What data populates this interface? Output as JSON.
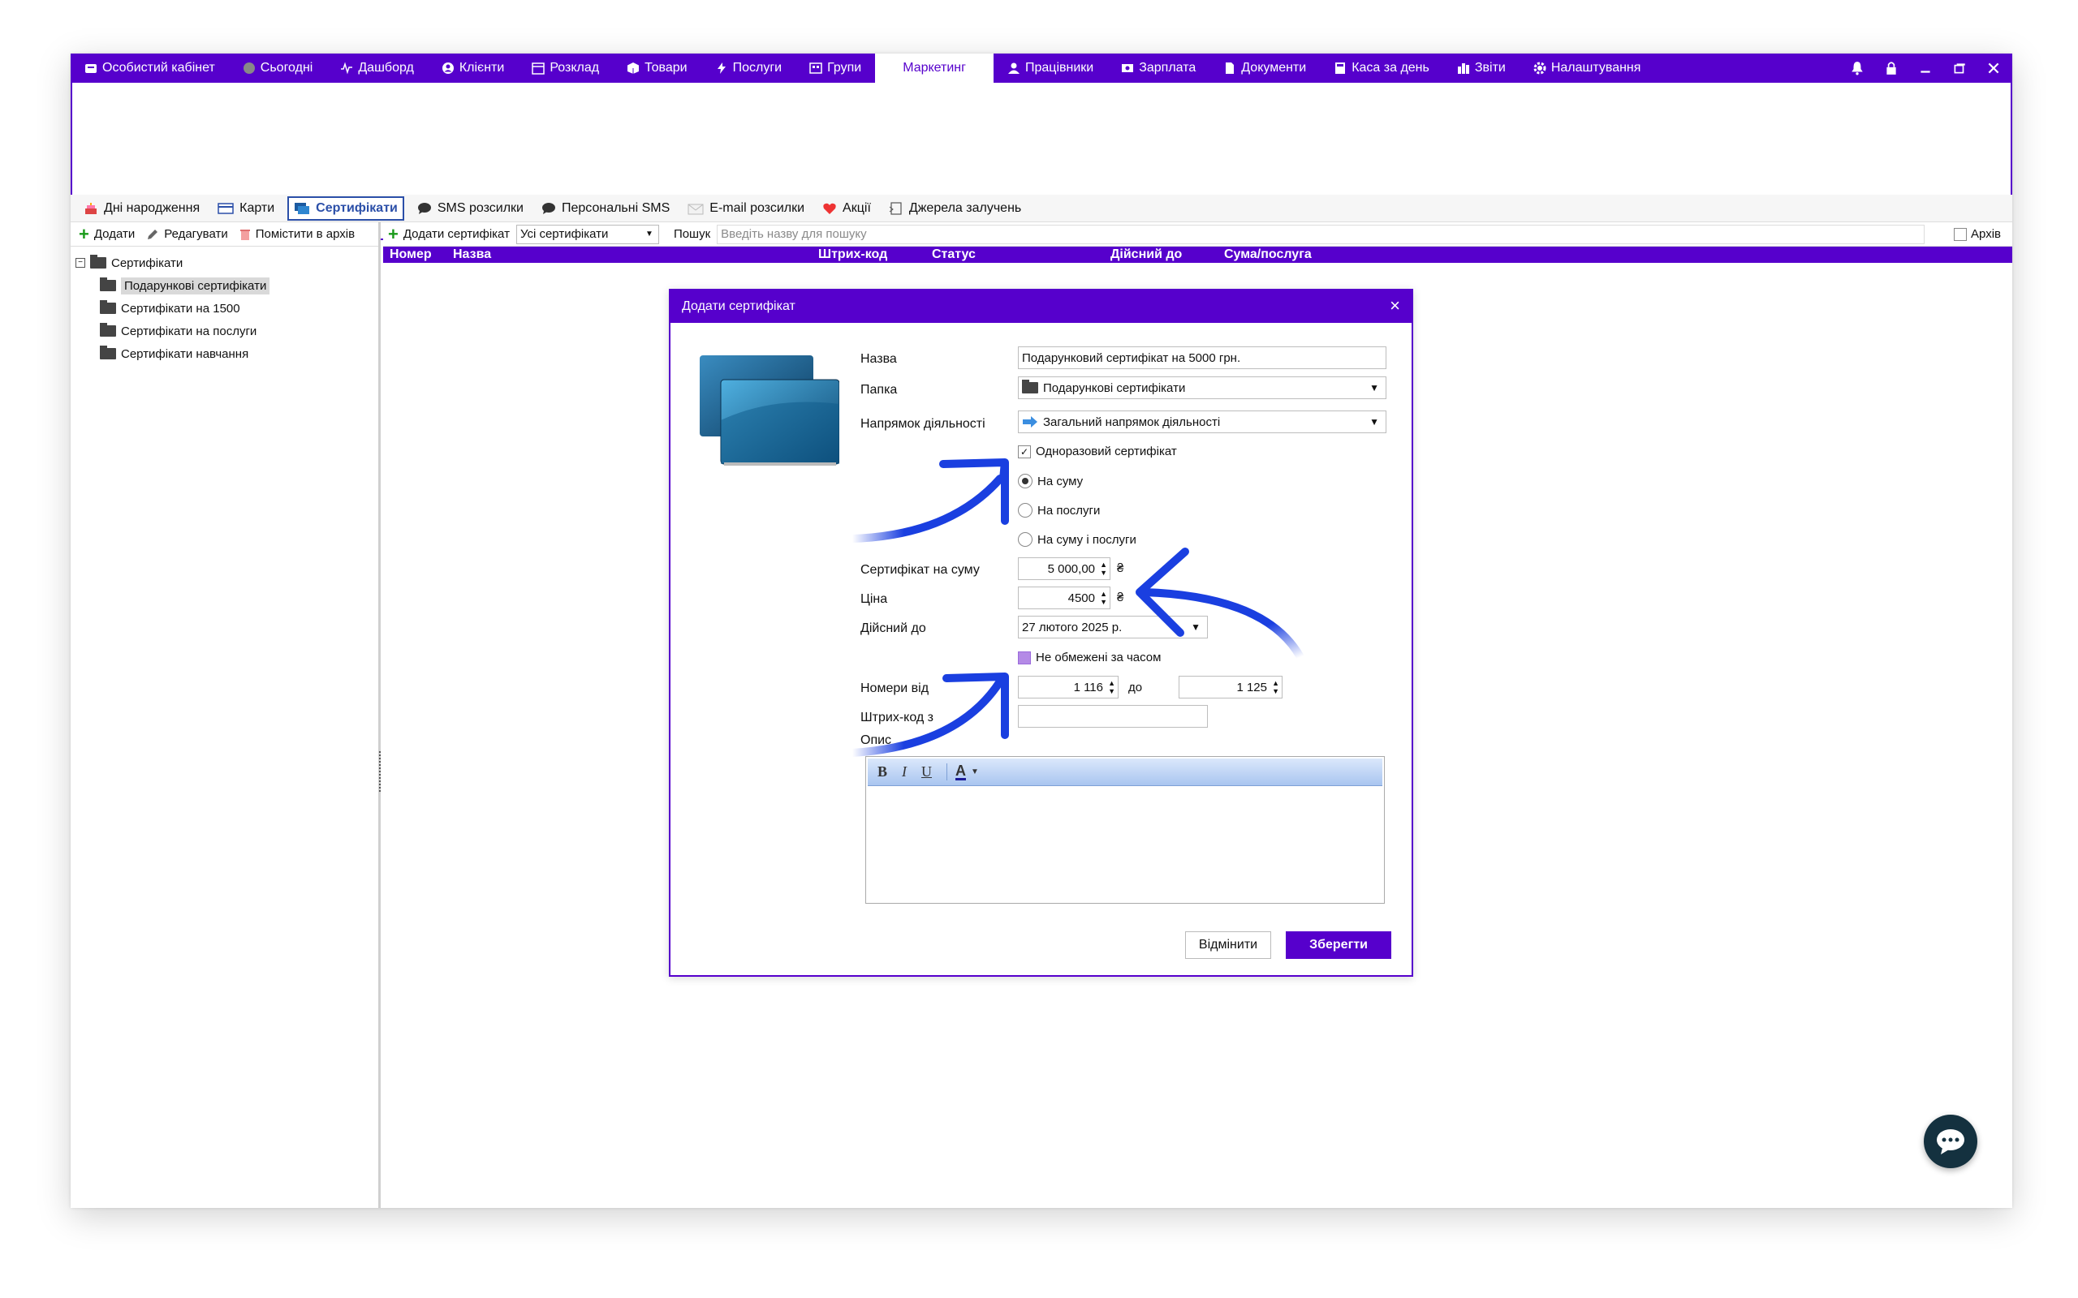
{
  "nav": {
    "items": [
      {
        "label": "Особистий кабінет",
        "icon": "inbox-icon"
      },
      {
        "label": "Сьогодні",
        "icon": "circle-icon"
      },
      {
        "label": "Дашборд",
        "icon": "pulse-icon"
      },
      {
        "label": "Клієнти",
        "icon": "user-circle-icon"
      },
      {
        "label": "Розклад",
        "icon": "calendar-icon"
      },
      {
        "label": "Товари",
        "icon": "box-icon"
      },
      {
        "label": "Послуги",
        "icon": "bolt-icon"
      },
      {
        "label": "Групи",
        "icon": "group-icon"
      },
      {
        "label": "Маркетинг",
        "icon": "",
        "active": true
      },
      {
        "label": "Працівники",
        "icon": "person-icon"
      },
      {
        "label": "Зарплата",
        "icon": "money-icon"
      },
      {
        "label": "Документи",
        "icon": "document-icon"
      },
      {
        "label": "Каса за день",
        "icon": "calculator-icon"
      },
      {
        "label": "Звіти",
        "icon": "bar-chart-icon"
      },
      {
        "label": "Налаштування",
        "icon": "gear-icon"
      }
    ]
  },
  "subtabs": [
    {
      "label": "Дні народження",
      "icon": "cake-icon"
    },
    {
      "label": "Карти",
      "icon": "card-icon"
    },
    {
      "label": "Сертифікати",
      "icon": "certificate-icon",
      "active": true
    },
    {
      "label": "SMS розсилки",
      "icon": "chat-bubble-icon"
    },
    {
      "label": "Персональні SMS",
      "icon": "chat-bubble-icon"
    },
    {
      "label": "E-mail розсилки",
      "icon": "email-icon"
    },
    {
      "label": "Акції",
      "icon": "heart-icon"
    },
    {
      "label": "Джерела залучень",
      "icon": "source-icon"
    }
  ],
  "left_toolbar": {
    "add": "Додати",
    "edit": "Редагувати",
    "archive": "Помістити в архів"
  },
  "tree": {
    "root": "Сертифікати",
    "children": [
      "Подарункові сертифікати",
      "Сертифікати на 1500",
      "Сертифікати на послуги",
      "Сертифікати навчання"
    ]
  },
  "right_toolbar": {
    "add_cert": "Додати сертифікат",
    "filter": "Усі сертифікати",
    "search_label": "Пошук",
    "search_placeholder": "Введіть назву для пошуку",
    "archive": "Архів"
  },
  "grid": {
    "columns": [
      "Номер",
      "Назва",
      "Штрих-код",
      "Статус",
      "Дійсний до",
      "Сума/послуга"
    ]
  },
  "dialog": {
    "title": "Додати сертифікат",
    "labels": {
      "name": "Назва",
      "folder": "Папка",
      "direction": "Напрямок діяльності",
      "cert_sum": "Сертифікат на суму",
      "price": "Ціна",
      "valid_until": "Дійсний до",
      "numbers_from": "Номери від",
      "to": "до",
      "barcode_from": "Штрих-код з",
      "description": "Опис"
    },
    "values": {
      "name": "Подарунковий сертифікат на 5000 грн.",
      "folder": "Подарункові сертифікати",
      "direction": "Загальний напрямок діяльності",
      "cert_sum": "5 000,00",
      "price": "4500",
      "currency": "₴",
      "valid_until": "27  лютого  2025 р.",
      "number_from": "1 116",
      "number_to": "1 125",
      "barcode": ""
    },
    "one_time": "Одноразовий сертифікат",
    "radios": [
      "На суму",
      "На послуги",
      "На суму і послуги"
    ],
    "selected_radio": 0,
    "unlimited": "Не обмежені за часом",
    "editor_buttons": [
      "B",
      "I",
      "U",
      "A"
    ],
    "cancel": "Відмінити",
    "save": "Зберегти"
  },
  "colors": {
    "accent": "#5600cc",
    "arrow": "#1a3fe0"
  }
}
